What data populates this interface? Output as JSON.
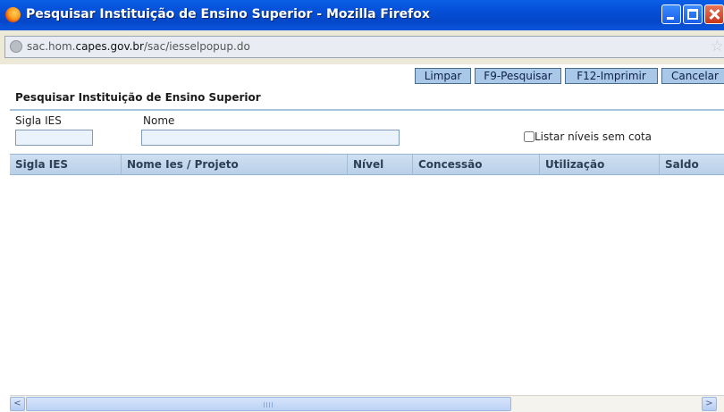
{
  "window": {
    "title": "Pesquisar Instituição de Ensino Superior - Mozilla Firefox"
  },
  "address": {
    "url_prefix": "sac.hom.",
    "url_domain": "capes.gov.br",
    "url_path": "/sac/iesselpopup.do"
  },
  "toolbar": {
    "limpar": "Limpar",
    "pesquisar": "F9-Pesquisar",
    "imprimir": "F12-Imprimir",
    "cancelar": "Cancelar"
  },
  "page": {
    "title": "Pesquisar Instituição de Ensino Superior"
  },
  "form": {
    "sigla_label": "Sigla IES",
    "sigla_value": "",
    "nome_label": "Nome",
    "nome_value": "",
    "checkbox_label": "Listar níveis sem cota",
    "checkbox_checked": false
  },
  "grid": {
    "columns": [
      "Sigla IES",
      "Nome Ies / Projeto",
      "Nível",
      "Concessão",
      "Utilização",
      "Saldo"
    ],
    "rows": []
  },
  "scrollbar": {
    "left_arrow": "<",
    "right_arrow": ">"
  }
}
